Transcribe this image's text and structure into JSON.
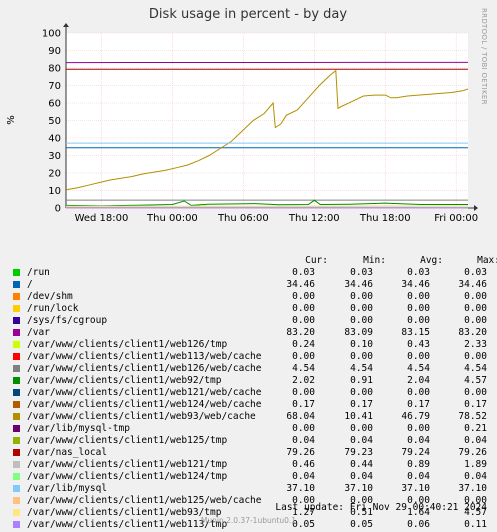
{
  "title": "Disk usage in percent - by day",
  "side_label": "RRDTOOL / TOBI OETIKER",
  "footer": {
    "last_update": "Last update: Fri Nov 29 00:40:21 2024",
    "version": "Munin 2.0.37-1ubuntu0.1"
  },
  "legend_headers": {
    "cur": "Cur:",
    "min": "Min:",
    "avg": "Avg:",
    "max": "Max:"
  },
  "chart_data": {
    "type": "line",
    "ylabel": "%",
    "ylim": [
      0,
      100
    ],
    "yticks": [
      0,
      10,
      20,
      30,
      40,
      50,
      60,
      70,
      80,
      90,
      100
    ],
    "xlim": [
      "Wed 15:00",
      "Fri 01:00"
    ],
    "xticks": [
      {
        "label": "Wed 18:00",
        "h": 3
      },
      {
        "label": "Thu 00:00",
        "h": 9
      },
      {
        "label": "Thu 06:00",
        "h": 15
      },
      {
        "label": "Thu 12:00",
        "h": 21
      },
      {
        "label": "Thu 18:00",
        "h": 27
      },
      {
        "label": "Fri 00:00",
        "h": 33
      }
    ],
    "grid": true,
    "series": [
      {
        "name": "/run",
        "color": "#00cc00",
        "cur": "0.03",
        "min": "0.03",
        "avg": "0.03",
        "max": "0.03",
        "points": [
          [
            0,
            0.03
          ],
          [
            34,
            0.03
          ]
        ]
      },
      {
        "name": "/",
        "color": "#0066b3",
        "cur": "34.46",
        "min": "34.46",
        "avg": "34.46",
        "max": "34.46",
        "points": [
          [
            0,
            34.46
          ],
          [
            34,
            34.46
          ]
        ]
      },
      {
        "name": "/dev/shm",
        "color": "#ff8000",
        "cur": "0.00",
        "min": "0.00",
        "avg": "0.00",
        "max": "0.00",
        "points": [
          [
            0,
            0
          ],
          [
            34,
            0
          ]
        ]
      },
      {
        "name": "/run/lock",
        "color": "#ffcc00",
        "cur": "0.00",
        "min": "0.00",
        "avg": "0.00",
        "max": "0.00",
        "points": [
          [
            0,
            0
          ],
          [
            34,
            0
          ]
        ]
      },
      {
        "name": "/sys/fs/cgroup",
        "color": "#330099",
        "cur": "0.00",
        "min": "0.00",
        "avg": "0.00",
        "max": "0.00",
        "points": [
          [
            0,
            0
          ],
          [
            34,
            0
          ]
        ]
      },
      {
        "name": "/var",
        "color": "#990099",
        "cur": "83.20",
        "min": "83.09",
        "avg": "83.15",
        "max": "83.20",
        "points": [
          [
            0,
            83.1
          ],
          [
            10,
            83.12
          ],
          [
            18,
            83.15
          ],
          [
            25,
            83.18
          ],
          [
            34,
            83.2
          ]
        ]
      },
      {
        "name": "/var/www/clients/client1/web126/tmp",
        "color": "#ccff00",
        "cur": "0.24",
        "min": "0.10",
        "avg": "0.43",
        "max": "2.33",
        "points": [
          [
            0,
            0.3
          ],
          [
            11,
            0.4
          ],
          [
            11.5,
            2.33
          ],
          [
            12,
            0.4
          ],
          [
            34,
            0.24
          ]
        ]
      },
      {
        "name": "/var/www/clients/client1/web113/web/cache",
        "color": "#ff0000",
        "cur": "0.00",
        "min": "0.00",
        "avg": "0.00",
        "max": "0.00",
        "points": [
          [
            0,
            0
          ],
          [
            34,
            0
          ]
        ]
      },
      {
        "name": "/var/www/clients/client1/web126/web/cache",
        "color": "#808080",
        "cur": "4.54",
        "min": "4.54",
        "avg": "4.54",
        "max": "4.54",
        "points": [
          [
            0,
            4.54
          ],
          [
            34,
            4.54
          ]
        ]
      },
      {
        "name": "/var/www/clients/client1/web92/tmp",
        "color": "#008f00",
        "cur": "2.02",
        "min": "0.91",
        "avg": "2.04",
        "max": "4.57",
        "points": [
          [
            0,
            1.5
          ],
          [
            3,
            1.2
          ],
          [
            6,
            1.6
          ],
          [
            9,
            2.0
          ],
          [
            10,
            4.0
          ],
          [
            10.6,
            1.5
          ],
          [
            12,
            2.2
          ],
          [
            16,
            2.5
          ],
          [
            18,
            1.8
          ],
          [
            20.5,
            2.0
          ],
          [
            21,
            4.4
          ],
          [
            21.5,
            2.0
          ],
          [
            24,
            2.2
          ],
          [
            27,
            2.8
          ],
          [
            30,
            2.0
          ],
          [
            34,
            2.02
          ]
        ]
      },
      {
        "name": "/var/www/clients/client1/web121/web/cache",
        "color": "#00487d",
        "cur": "0.00",
        "min": "0.00",
        "avg": "0.00",
        "max": "0.00",
        "points": [
          [
            0,
            0
          ],
          [
            34,
            0
          ]
        ]
      },
      {
        "name": "/var/www/clients/client1/web124/web/cache",
        "color": "#b35a00",
        "cur": "0.17",
        "min": "0.17",
        "avg": "0.17",
        "max": "0.17",
        "points": [
          [
            0,
            0.17
          ],
          [
            34,
            0.17
          ]
        ]
      },
      {
        "name": "/var/www/clients/client1/web93/web/cache",
        "color": "#b38f00",
        "cur": "68.04",
        "min": "10.41",
        "avg": "46.79",
        "max": "78.52",
        "points": [
          [
            0,
            10.4
          ],
          [
            1,
            11.5
          ],
          [
            2,
            13
          ],
          [
            3,
            14.5
          ],
          [
            4,
            16
          ],
          [
            5,
            17
          ],
          [
            6,
            18
          ],
          [
            7,
            19.5
          ],
          [
            8,
            20.5
          ],
          [
            9,
            21.5
          ],
          [
            10,
            23
          ],
          [
            11,
            24.5
          ],
          [
            12,
            27
          ],
          [
            13,
            30
          ],
          [
            14,
            34
          ],
          [
            15,
            38
          ],
          [
            16,
            44
          ],
          [
            17,
            50
          ],
          [
            18,
            54
          ],
          [
            18.8,
            60
          ],
          [
            19,
            46
          ],
          [
            19.5,
            48
          ],
          [
            20,
            53
          ],
          [
            21,
            56
          ],
          [
            22,
            63
          ],
          [
            23,
            70
          ],
          [
            24,
            76
          ],
          [
            24.5,
            78.5
          ],
          [
            24.7,
            57
          ],
          [
            25,
            58
          ],
          [
            26,
            61
          ],
          [
            27,
            64
          ],
          [
            28,
            64.5
          ],
          [
            29,
            64.5
          ],
          [
            29.5,
            63
          ],
          [
            30,
            63
          ],
          [
            31,
            64
          ],
          [
            32,
            64.5
          ],
          [
            33,
            65
          ],
          [
            34,
            65.5
          ],
          [
            35,
            66
          ],
          [
            36,
            67
          ],
          [
            36.5,
            68
          ]
        ]
      },
      {
        "name": "/var/lib/mysql-tmp",
        "color": "#6b006b",
        "cur": "0.00",
        "min": "0.00",
        "avg": "0.00",
        "max": "0.21",
        "points": [
          [
            0,
            0
          ],
          [
            34,
            0
          ]
        ]
      },
      {
        "name": "/var/www/clients/client1/web125/tmp",
        "color": "#8fb300",
        "cur": "0.04",
        "min": "0.04",
        "avg": "0.04",
        "max": "0.04",
        "points": [
          [
            0,
            0.04
          ],
          [
            34,
            0.04
          ]
        ]
      },
      {
        "name": "/var/nas_local",
        "color": "#b30000",
        "cur": "79.26",
        "min": "79.23",
        "avg": "79.24",
        "max": "79.26",
        "points": [
          [
            0,
            79.23
          ],
          [
            34,
            79.26
          ]
        ]
      },
      {
        "name": "/var/www/clients/client1/web121/tmp",
        "color": "#bebebe",
        "cur": "0.46",
        "min": "0.44",
        "avg": "0.89",
        "max": "1.89",
        "points": [
          [
            0,
            0.5
          ],
          [
            34,
            0.46
          ]
        ]
      },
      {
        "name": "/var/www/clients/client1/web124/tmp",
        "color": "#80ff80",
        "cur": "0.04",
        "min": "0.04",
        "avg": "0.04",
        "max": "0.04",
        "points": [
          [
            0,
            0.04
          ],
          [
            34,
            0.04
          ]
        ]
      },
      {
        "name": "/var/lib/mysql",
        "color": "#80c9ff",
        "cur": "37.10",
        "min": "37.10",
        "avg": "37.10",
        "max": "37.10",
        "points": [
          [
            0,
            37.1
          ],
          [
            34,
            37.1
          ]
        ]
      },
      {
        "name": "/var/www/clients/client1/web125/web/cache",
        "color": "#ffc080",
        "cur": "0.00",
        "min": "0.00",
        "avg": "0.00",
        "max": "0.00",
        "points": [
          [
            0,
            0
          ],
          [
            34,
            0
          ]
        ]
      },
      {
        "name": "/var/www/clients/client1/web93/tmp",
        "color": "#ffe680",
        "cur": "1.27",
        "min": "0.51",
        "avg": "1.64",
        "max": "4.57",
        "points": [
          [
            0,
            1.0
          ],
          [
            34,
            1.27
          ]
        ]
      },
      {
        "name": "/var/www/clients/client1/web113/tmp",
        "color": "#aa80ff",
        "cur": "0.05",
        "min": "0.05",
        "avg": "0.06",
        "max": "0.11",
        "points": [
          [
            0,
            0.05
          ],
          [
            34,
            0.05
          ]
        ]
      }
    ]
  }
}
